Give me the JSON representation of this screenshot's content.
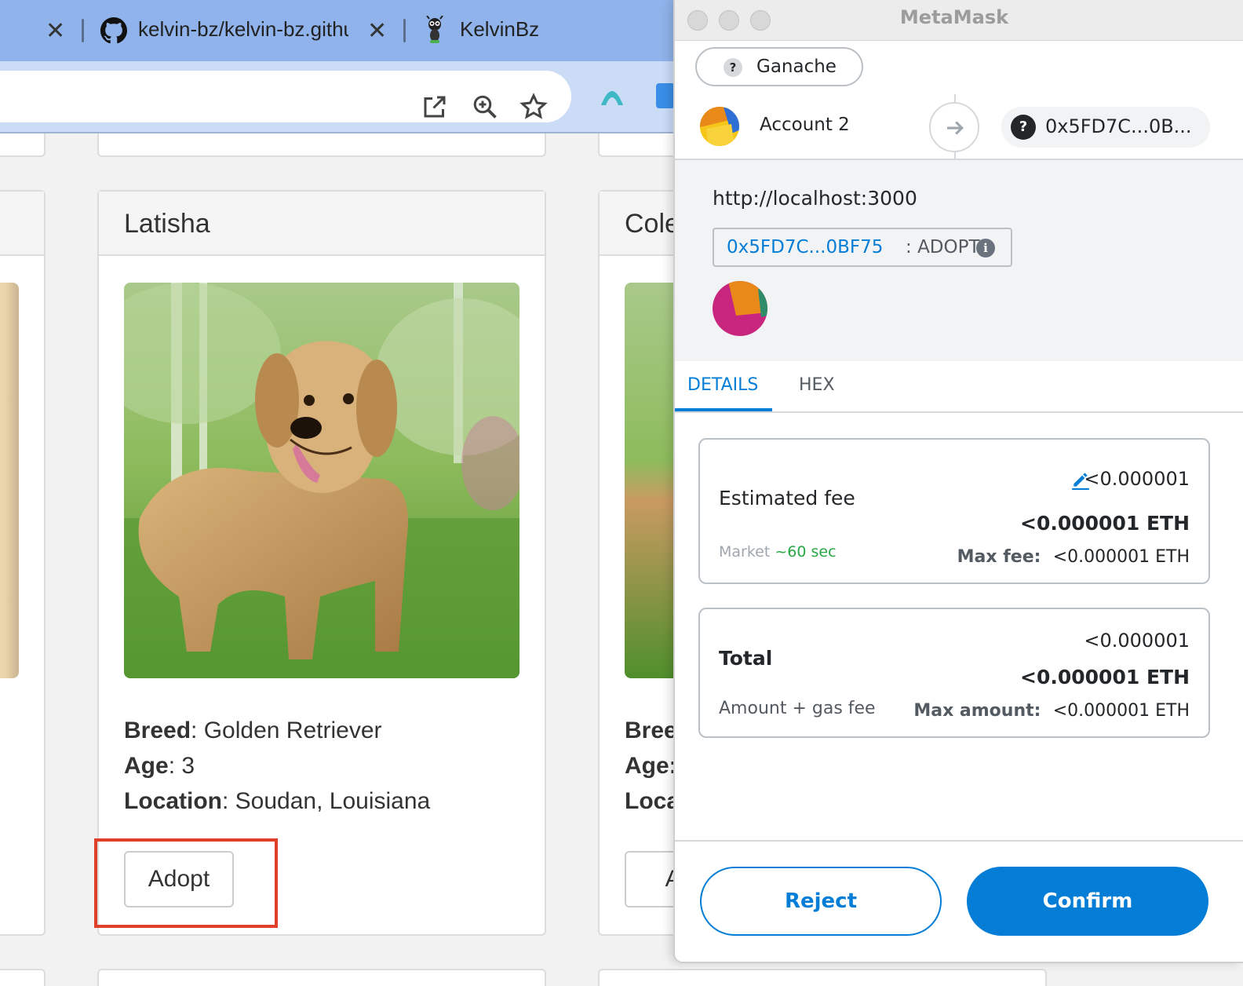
{
  "browser": {
    "tabs": [
      {
        "title": "",
        "close": "✕"
      },
      {
        "title": "kelvin-bz/kelvin-bz.githu",
        "close": "✕"
      },
      {
        "title": "KelvinBz"
      }
    ],
    "toolbar_icons": [
      "open-in-new-icon",
      "zoom-icon",
      "bookmark-star-icon"
    ],
    "extensions": [
      "vpn-extension-icon",
      "droplet-extension-icon"
    ]
  },
  "page": {
    "cards": [
      {
        "name": "Latisha",
        "breed_label": "Breed",
        "breed": "Golden Retriever",
        "age_label": "Age",
        "age": "3",
        "location_label": "Location",
        "location": "Soudan, Louisiana",
        "button": "Adopt"
      },
      {
        "name": "Cole",
        "breed_label": "Bree",
        "age_label": "Age:",
        "location_label": "Loca",
        "button": "Ad"
      }
    ],
    "highlight_color": "#e0402a"
  },
  "metamask": {
    "window_title": "MetaMask",
    "network": "Ganache",
    "account": "Account 2",
    "recipient": "0x5FD7C...0B...",
    "origin": "http://localhost:3000",
    "contract_address": "0x5FD7C...0BF75",
    "method_sep": ":",
    "method": "ADOPT",
    "tabs": [
      "DETAILS",
      "HEX"
    ],
    "fee": {
      "label": "Estimated fee",
      "value": "<0.000001",
      "value_eth": "<0.000001 ETH",
      "speed_label": "Market",
      "speed_time": "~60 sec",
      "max_label": "Max fee:",
      "max_value": "<0.000001 ETH"
    },
    "total": {
      "label": "Total",
      "value": "<0.000001",
      "value_eth": "<0.000001 ETH",
      "sub_label": "Amount + gas fee",
      "max_label": "Max amount:",
      "max_value": "<0.000001 ETH"
    },
    "reject": "Reject",
    "confirm": "Confirm",
    "accent_color": "#037dd6"
  }
}
